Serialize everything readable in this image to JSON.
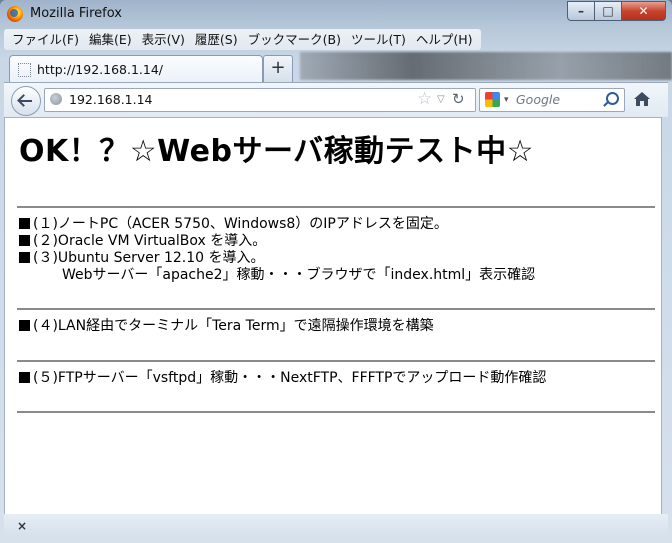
{
  "window": {
    "title": "Mozilla Firefox"
  },
  "window_buttons": {
    "minimize": "–",
    "maximize": "□",
    "close": "✕"
  },
  "menu": [
    "ファイル(F)",
    "編集(E)",
    "表示(V)",
    "履歴(S)",
    "ブックマーク(B)",
    "ツール(T)",
    "ヘルプ(H)"
  ],
  "tab": {
    "label": "http://192.168.1.14/",
    "new_tab_label": "+"
  },
  "nav": {
    "url": "192.168.1.14",
    "search_placeholder": "Google"
  },
  "page": {
    "heading": "OK！？☆Webサーバ稼動テスト中☆",
    "lines": [
      "(１)ノートPC（ACER 5750、Windows8）のIPアドレスを固定。",
      "(２)Oracle VM VirtualBox を導入。",
      "(３)Ubuntu Server 12.10 を導入。",
      "Webサーバー「apache2」稼動・・・ブラウザで「index.html」表示確認",
      "(４)LAN経由でターミナル「Tera Term」で遠隔操作環境を構築",
      "(５)FTPサーバー「vsftpd」稼動・・・NextFTP、FFFTPでアップロード動作確認"
    ]
  },
  "statusbar": {
    "close_label": "×"
  }
}
